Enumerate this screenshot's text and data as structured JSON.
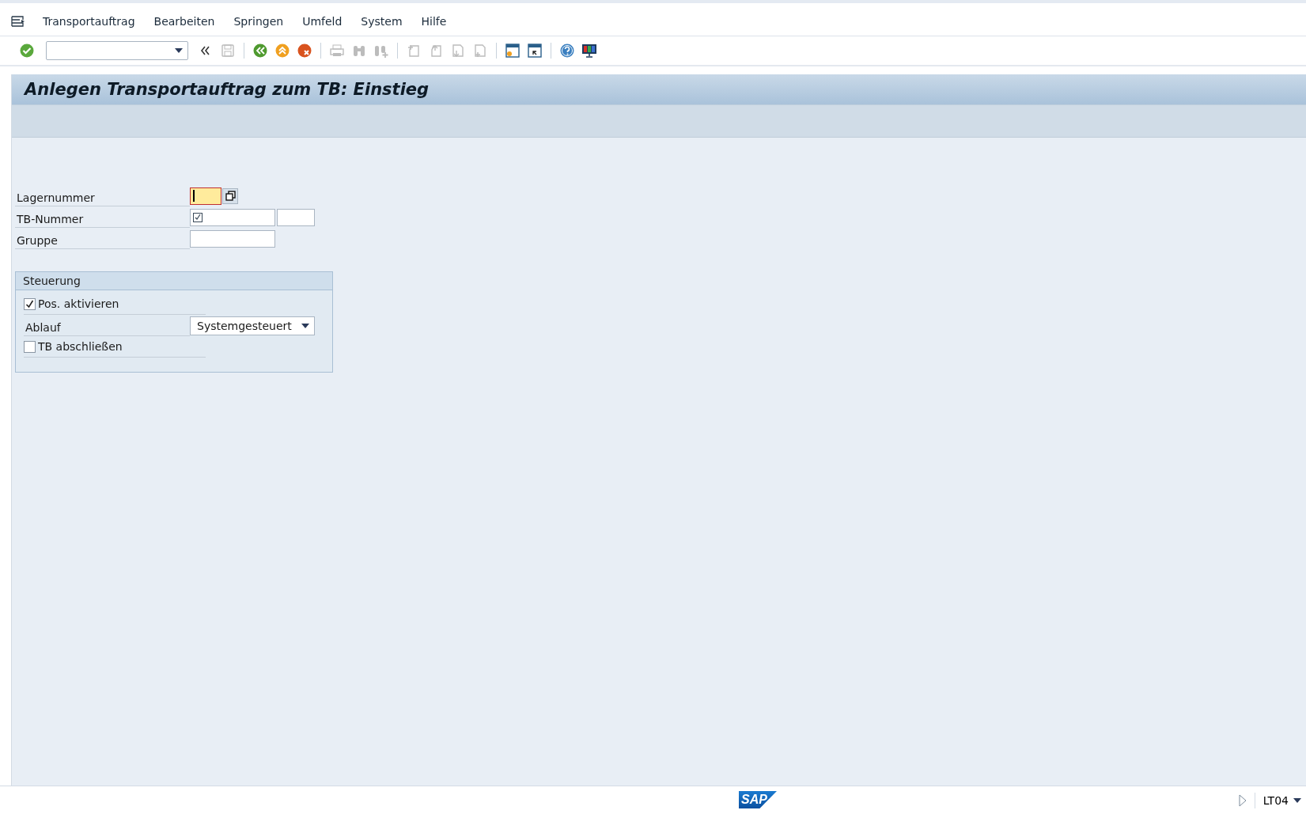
{
  "menu": [
    {
      "label": "Transportauftrag"
    },
    {
      "label": "Bearbeiten"
    },
    {
      "label": "Springen"
    },
    {
      "label": "Umfeld"
    },
    {
      "label": "System"
    },
    {
      "label": "Hilfe"
    }
  ],
  "toolbar": [
    {
      "kind": "enter",
      "disabled": false
    },
    {
      "kind": "command"
    },
    {
      "kind": "collapse",
      "disabled": false
    },
    {
      "kind": "save",
      "disabled": true
    },
    {
      "kind": "sep"
    },
    {
      "kind": "back",
      "disabled": false
    },
    {
      "kind": "exit",
      "disabled": false
    },
    {
      "kind": "cancel",
      "disabled": false
    },
    {
      "kind": "sep"
    },
    {
      "kind": "print",
      "disabled": true
    },
    {
      "kind": "find",
      "disabled": true
    },
    {
      "kind": "findnext",
      "disabled": true
    },
    {
      "kind": "sep"
    },
    {
      "kind": "first",
      "disabled": true
    },
    {
      "kind": "prev",
      "disabled": true
    },
    {
      "kind": "next",
      "disabled": true
    },
    {
      "kind": "last",
      "disabled": true
    },
    {
      "kind": "sep"
    },
    {
      "kind": "session",
      "disabled": false
    },
    {
      "kind": "shortcut",
      "disabled": false
    },
    {
      "kind": "sep"
    },
    {
      "kind": "help",
      "disabled": false
    },
    {
      "kind": "layout",
      "disabled": false
    }
  ],
  "title": "Anlegen Transportauftrag zum TB: Einstieg",
  "fields": [
    {
      "label": "Lagernummer",
      "kind": "focused"
    },
    {
      "label": "TB-Nummer",
      "kind": "required"
    },
    {
      "label": "Gruppe",
      "kind": "plain"
    }
  ],
  "group": {
    "title": "Steuerung",
    "items": [
      {
        "kind": "checkbox",
        "label": "Pos. aktivieren",
        "checked": true
      },
      {
        "kind": "dropdown",
        "label": "Ablauf",
        "value": "Systemgesteuert"
      },
      {
        "kind": "checkbox",
        "label": "TB abschließen",
        "checked": false
      }
    ]
  },
  "status_bar": {
    "logo": "SAP",
    "transaction": "LT04"
  }
}
